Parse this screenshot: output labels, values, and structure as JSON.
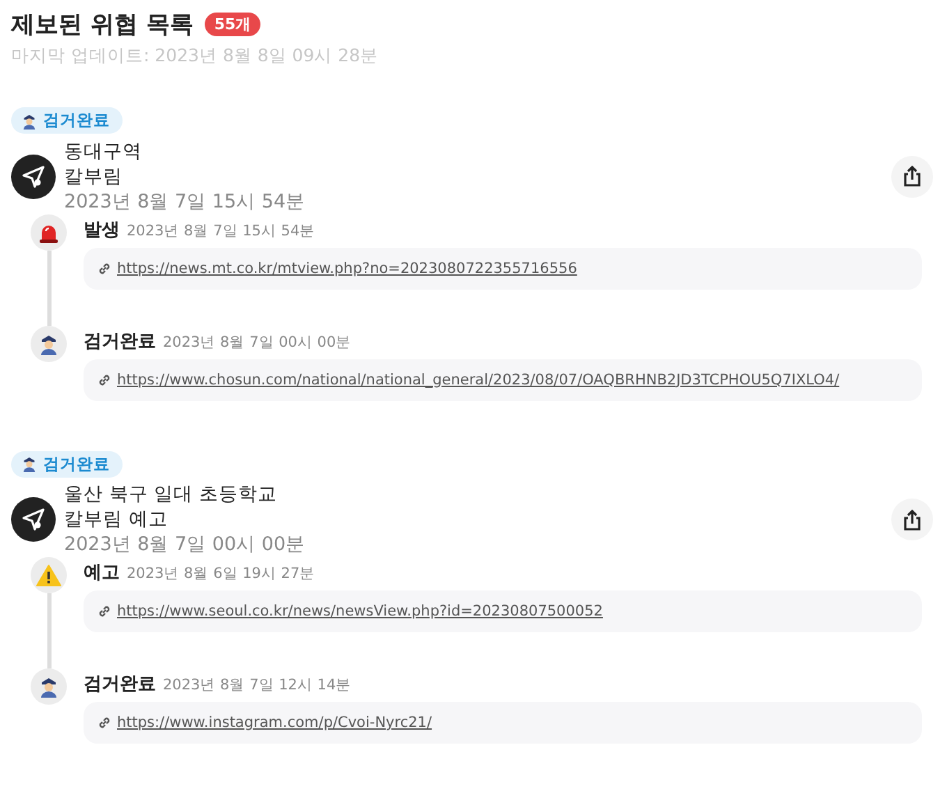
{
  "header": {
    "title": "제보된 위협 목록",
    "count": "55개",
    "updated": "마지막 업데이트: 2023년 8월 8일 09시 28분"
  },
  "reports": [
    {
      "status": {
        "kind": "arrested",
        "label": "검거완료"
      },
      "location": "동대구역",
      "category": "칼부림",
      "date": "2023년 8월 7일 15시 54분",
      "events": [
        {
          "kind": "occurred",
          "label": "발생",
          "date": "2023년 8월 7일 15시 54분",
          "url": "https://news.mt.co.kr/mtview.php?no=2023080722355716556"
        },
        {
          "kind": "arrested",
          "label": "검거완료",
          "date": "2023년 8월 7일 00시 00분",
          "url": "https://www.chosun.com/national/national_general/2023/08/07/OAQBRHNB2JD3TCPHOU5Q7IXLO4/"
        }
      ]
    },
    {
      "status": {
        "kind": "arrested",
        "label": "검거완료"
      },
      "location": "울산 북구 일대 초등학교",
      "category": "칼부림 예고",
      "date": "2023년 8월 7일 00시 00분",
      "events": [
        {
          "kind": "warning",
          "label": "예고",
          "date": "2023년 8월 6일 19시 27분",
          "url": "https://www.seoul.co.kr/news/newsView.php?id=20230807500052"
        },
        {
          "kind": "arrested",
          "label": "검거완료",
          "date": "2023년 8월 7일 12시 14분",
          "url": "https://www.instagram.com/p/Cvoi-Nyrc21/"
        }
      ]
    }
  ]
}
